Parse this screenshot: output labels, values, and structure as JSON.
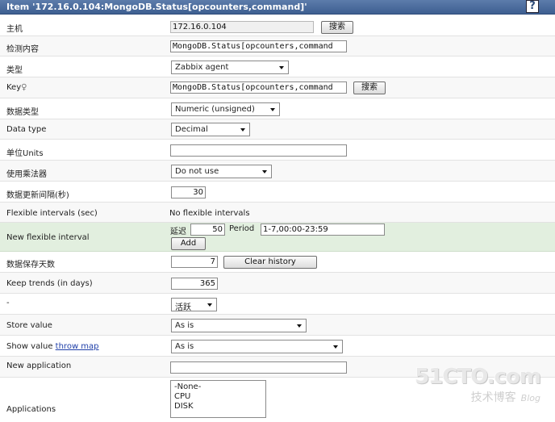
{
  "title": "Item '172.16.0.104:MongoDB.Status[opcounters,command]'",
  "help_label": "?",
  "host": {
    "label": "主机",
    "value": "172.16.0.104",
    "button": "搜索"
  },
  "description": {
    "label": "检测内容",
    "value": "MongoDB.Status[opcounters,command"
  },
  "type": {
    "label": "类型",
    "value": "Zabbix agent"
  },
  "key": {
    "label": "Key",
    "value": "MongoDB.Status[opcounters,command",
    "button": "搜索"
  },
  "value_type": {
    "label": "数据类型",
    "value": "Numeric (unsigned)"
  },
  "data_type": {
    "label": "Data type",
    "value": "Decimal"
  },
  "units": {
    "label": "单位Units",
    "value": ""
  },
  "multiplier": {
    "label": "使用乘法器",
    "value": "Do not use"
  },
  "delay": {
    "label": "数据更新间隔(秒)",
    "value": "30"
  },
  "flexible": {
    "label": "Flexible intervals (sec)",
    "value": "No flexible intervals"
  },
  "new_flexible": {
    "label": "New flexible interval",
    "delay_label": "延迟",
    "delay_value": "50",
    "period_label": "Period",
    "period_value": "1-7,00:00-23:59",
    "add_button": "Add"
  },
  "history": {
    "label": "数据保存天数",
    "value": "7",
    "button": "Clear history"
  },
  "trends": {
    "label": "Keep trends (in days)",
    "value": "365"
  },
  "status": {
    "label": "-",
    "value": "活跃"
  },
  "store_value": {
    "label": "Store value",
    "value": "As is"
  },
  "show_value": {
    "label": "Show value",
    "link": "throw map",
    "value": "As is"
  },
  "new_application": {
    "label": "New application",
    "value": ""
  },
  "applications": {
    "label": "Applications",
    "options": [
      "-None-",
      "CPU",
      "DISK"
    ]
  },
  "watermark": {
    "site": "51CTO.com",
    "tagline": "技术博客",
    "blog": "Blog"
  }
}
